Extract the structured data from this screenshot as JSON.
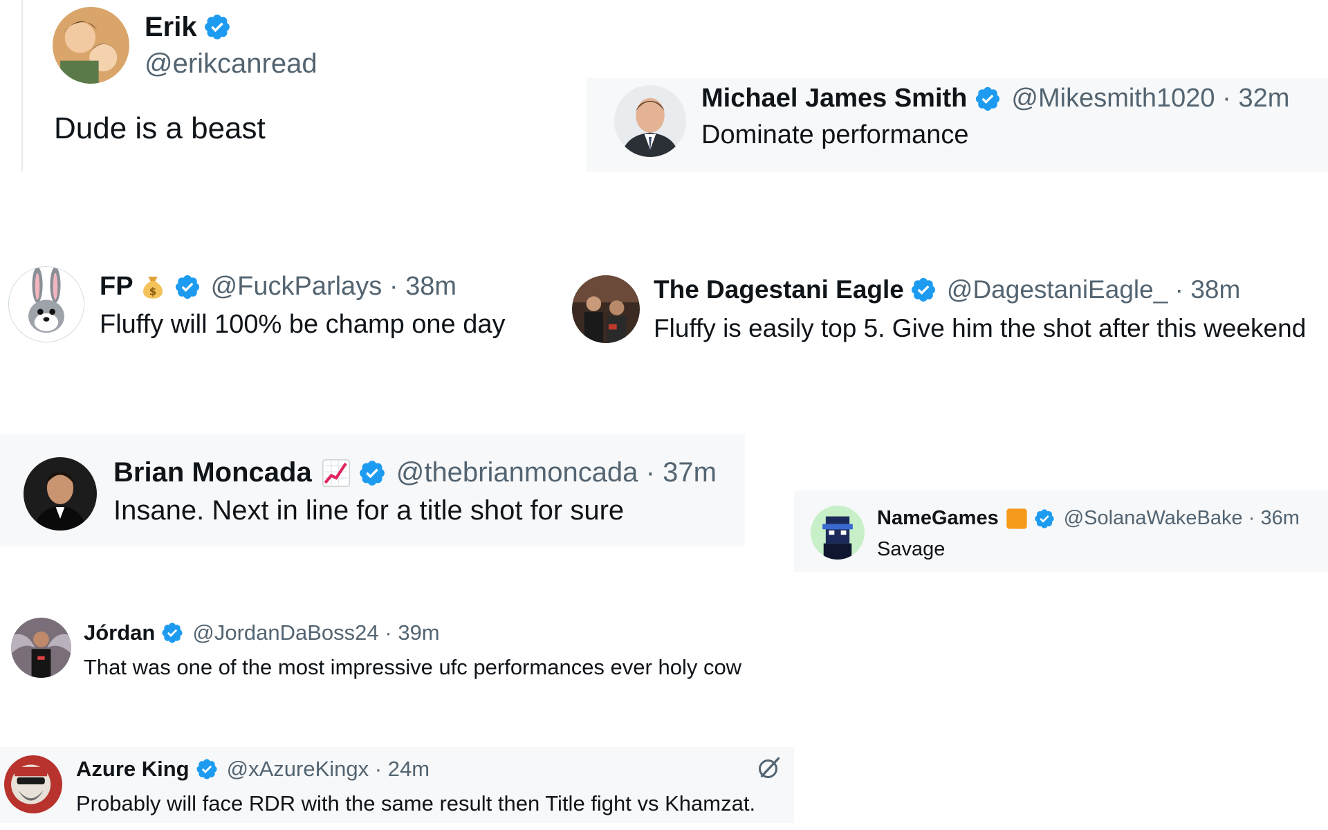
{
  "colors": {
    "verified": "#1d9bf0",
    "text_primary": "#0f1419",
    "text_secondary": "#536471",
    "shaded_bg": "#f7f8f9"
  },
  "separator": "·",
  "replies": [
    {
      "name": "Erik",
      "handle": "@erikcanread",
      "time": "",
      "text": "Dude is a beast",
      "verified": true,
      "emoji": ""
    },
    {
      "name": "Michael James Smith",
      "handle": "@Mikesmith1020",
      "time": "32m",
      "text": "Dominate performance",
      "verified": true,
      "emoji": ""
    },
    {
      "name": "FP",
      "handle": "@FuckParlays",
      "time": "38m",
      "text": "Fluffy will 100% be champ one day",
      "verified": true,
      "emoji": "money-bag-icon"
    },
    {
      "name": "The Dagestani Eagle",
      "handle": "@DagestaniEagle_",
      "time": "38m",
      "text": "Fluffy is easily top 5. Give him the shot after this weekend",
      "verified": true,
      "emoji": ""
    },
    {
      "name": "Brian Moncada",
      "handle": "@thebrianmoncada",
      "time": "37m",
      "text": "Insane. Next in line for a title shot for sure",
      "verified": true,
      "emoji": "chart-increasing-icon"
    },
    {
      "name": "NameGames",
      "handle": "@SolanaWakeBake",
      "time": "36m",
      "text": "Savage",
      "verified": true,
      "emoji": "orange-square-icon"
    },
    {
      "name": "Jórdan",
      "handle": "@JordanDaBoss24",
      "time": "39m",
      "text": "That was one of the most impressive ufc performances ever holy cow",
      "verified": true,
      "emoji": ""
    },
    {
      "name": "Azure King",
      "handle": "@xAzureKingx",
      "time": "24m",
      "text": "Probably will face RDR with the same result then Title fight vs Khamzat.",
      "verified": true,
      "emoji": "",
      "action_icon": "grok-icon"
    }
  ]
}
